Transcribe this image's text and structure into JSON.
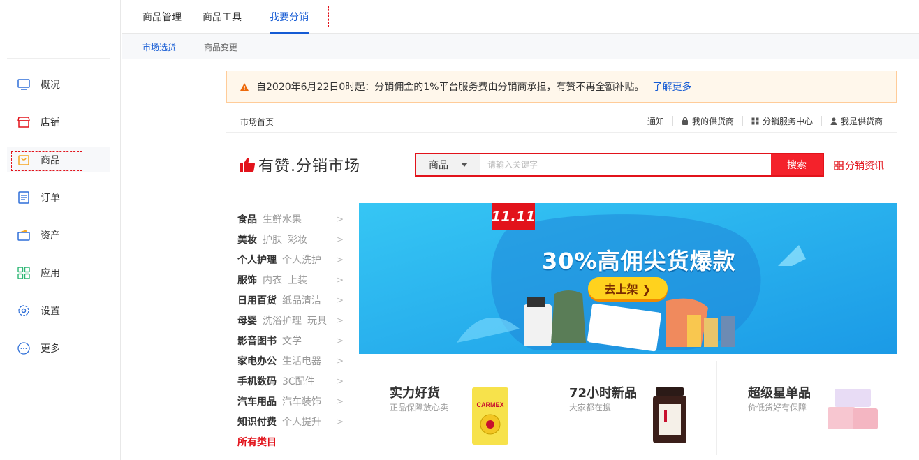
{
  "sidebar": {
    "items": [
      {
        "label": "概况",
        "icon": "monitor-icon"
      },
      {
        "label": "店铺",
        "icon": "store-icon"
      },
      {
        "label": "商品",
        "icon": "shopping-bag-icon"
      },
      {
        "label": "订单",
        "icon": "order-list-icon"
      },
      {
        "label": "资产",
        "icon": "wallet-icon"
      },
      {
        "label": "应用",
        "icon": "apps-grid-icon"
      },
      {
        "label": "设置",
        "icon": "gear-icon"
      },
      {
        "label": "更多",
        "icon": "more-dots-icon"
      }
    ],
    "active": "商品"
  },
  "topnav": {
    "tabs": [
      "商品管理",
      "商品工具",
      "我要分销"
    ],
    "active": "我要分销"
  },
  "subnav": {
    "tabs": [
      "市场选货",
      "商品变更"
    ],
    "active": "市场选货"
  },
  "notice": {
    "text": "自2020年6月22日0时起：分销佣金的1%平台服务费由分销商承担，有赞不再全额补贴。",
    "link": "了解更多"
  },
  "market_bar": {
    "home": "市场首页",
    "links": [
      "通知",
      "我的供货商",
      "分销服务中心",
      "我是供货商"
    ]
  },
  "brand": {
    "name": "有赞.分销市场"
  },
  "search": {
    "category": "商品",
    "placeholder": "请输入关键字",
    "button": "搜索",
    "news_link": "分销资讯"
  },
  "categories": [
    {
      "main": "食品",
      "subs": [
        "生鲜水果"
      ]
    },
    {
      "main": "美妆",
      "subs": [
        "护肤",
        "彩妆"
      ]
    },
    {
      "main": "个人护理",
      "subs": [
        "个人洗护"
      ]
    },
    {
      "main": "服饰",
      "subs": [
        "内衣",
        "上装"
      ]
    },
    {
      "main": "日用百货",
      "subs": [
        "纸品清洁"
      ]
    },
    {
      "main": "母婴",
      "subs": [
        "洗浴护理",
        "玩具"
      ]
    },
    {
      "main": "影音图书",
      "subs": [
        "文学"
      ]
    },
    {
      "main": "家电办公",
      "subs": [
        "生活电器"
      ]
    },
    {
      "main": "手机数码",
      "subs": [
        "3C配件"
      ]
    },
    {
      "main": "汽车用品",
      "subs": [
        "汽车装饰"
      ]
    },
    {
      "main": "知识付费",
      "subs": [
        "个人提升"
      ]
    }
  ],
  "all_categories": "所有类目",
  "banner": {
    "badge": "11.11",
    "headline": "30%高佣尖货爆款",
    "cta": "去上架 ❯",
    "colors": {
      "bg": "#29b7f0",
      "badge": "#e2131b",
      "cta": "#ffd21e"
    }
  },
  "promos": [
    {
      "title": "实力好货",
      "subtitle": "正品保障放心卖",
      "image_text": "CARMEX"
    },
    {
      "title": "72小时新品",
      "subtitle": "大家都在搜"
    },
    {
      "title": "超级星单品",
      "subtitle": "价低货好有保障"
    }
  ],
  "colors": {
    "accent": "#155bd4",
    "brand_red": "#e2131b",
    "search_btn": "#f4222b"
  }
}
